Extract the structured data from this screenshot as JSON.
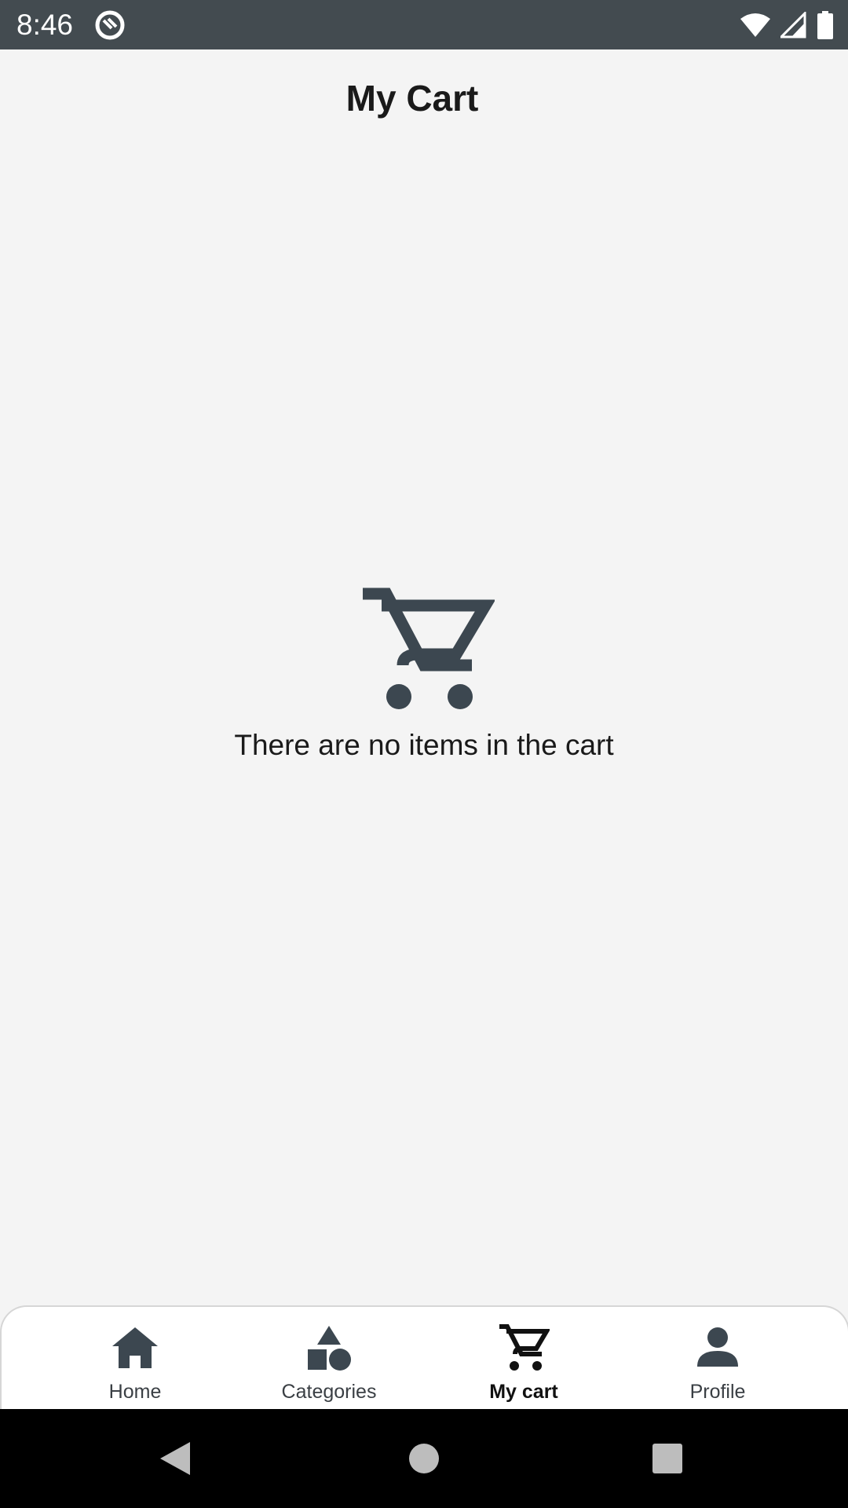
{
  "status_bar": {
    "time": "8:46",
    "icons": [
      "app-notification-icon",
      "wifi-icon",
      "cellular-signal-icon",
      "battery-icon"
    ]
  },
  "header": {
    "title": "My Cart"
  },
  "empty_state": {
    "icon": "shopping-cart-icon",
    "message": "There are no items in the cart"
  },
  "bottom_nav": {
    "active_index": 2,
    "items": [
      {
        "label": "Home",
        "icon": "home-icon"
      },
      {
        "label": "Categories",
        "icon": "categories-icon"
      },
      {
        "label": "My cart",
        "icon": "cart-icon"
      },
      {
        "label": "Profile",
        "icon": "profile-icon"
      }
    ]
  },
  "system_nav": {
    "icons": [
      "back-icon",
      "home-circle-icon",
      "recents-icon"
    ]
  },
  "colors": {
    "status_bar": "#434b50",
    "icon": "#3c4750",
    "background": "#f4f4f4"
  }
}
